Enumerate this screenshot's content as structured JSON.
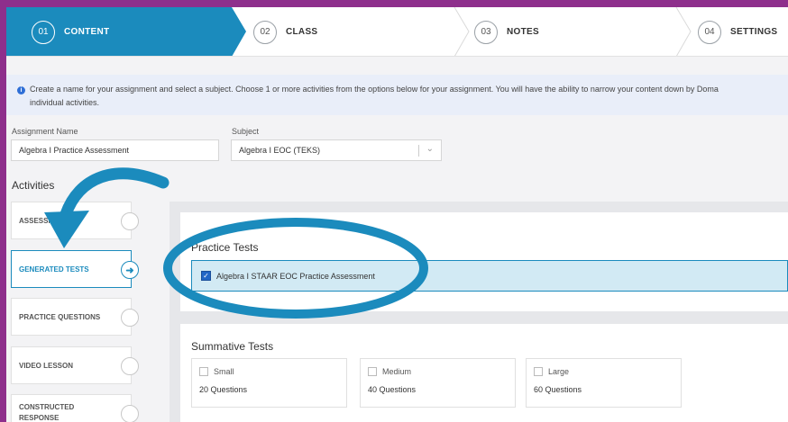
{
  "stepper": {
    "steps": [
      {
        "num": "01",
        "label": "CONTENT"
      },
      {
        "num": "02",
        "label": "CLASS"
      },
      {
        "num": "03",
        "label": "NOTES"
      },
      {
        "num": "04",
        "label": "SETTINGS"
      }
    ],
    "active_color": "#1b8bbd"
  },
  "info": {
    "text": "Create a name for your assignment and select a subject. Choose 1 or more activities from the options below for your assignment. You will have the ability to narrow your content down by Doma",
    "text_line2": "individual activities."
  },
  "form": {
    "name_label": "Assignment Name",
    "name_value": "Algebra I Practice Assessment",
    "subject_label": "Subject",
    "subject_value": "Algebra I EOC (TEKS)"
  },
  "activities": {
    "heading": "Activities",
    "tabs": [
      {
        "label": "ASSESSME"
      },
      {
        "label": "GENERATED TESTS"
      },
      {
        "label": "PRACTICE QUESTIONS"
      },
      {
        "label": "VIDEO LESSON"
      },
      {
        "label": "CONSTRUCTED",
        "label2": "RESPONSE"
      }
    ]
  },
  "practice_tests": {
    "title": "Practice Tests",
    "option_label": "Algebra I STAAR EOC Practice Assessment",
    "option_checked": true
  },
  "summative_tests": {
    "title": "Summative Tests",
    "cards": [
      {
        "size": "Small",
        "questions": "20 Questions"
      },
      {
        "size": "Medium",
        "questions": "40 Questions"
      },
      {
        "size": "Large",
        "questions": "60 Questions"
      }
    ]
  },
  "annotation": {
    "arrow_color": "#1b8bbd",
    "ring_color": "#1b8bbd"
  }
}
